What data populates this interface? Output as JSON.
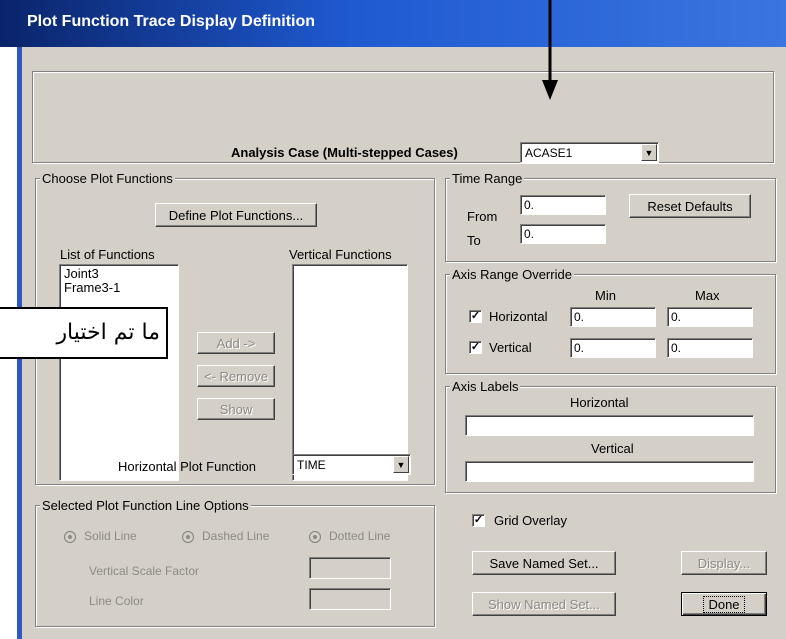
{
  "window": {
    "title": "Plot Function Trace Display Definition"
  },
  "analysis_case": {
    "label": "Analysis Case (Multi-stepped Cases)",
    "value": "ACASE1"
  },
  "choose_plot_functions": {
    "group_label": "Choose Plot Functions",
    "define_button": "Define Plot Functions...",
    "list_label": "List of Functions",
    "functions": [
      "Joint3",
      "Frame3-1"
    ],
    "vertical_label": "Vertical Functions",
    "add_button": "Add ->",
    "remove_button": "<- Remove",
    "show_button": "Show",
    "horizontal_plot_function_label": "Horizontal Plot Function",
    "horizontal_plot_function_value": "TIME"
  },
  "line_options": {
    "group_label": "Selected Plot Function Line Options",
    "solid": "Solid Line",
    "dashed": "Dashed Line",
    "dotted": "Dotted Line",
    "scale_label": "Vertical  Scale Factor",
    "color_label": "Line Color"
  },
  "time_range": {
    "group_label": "Time Range",
    "from_label": "From",
    "from_value": "0.",
    "to_label": "To",
    "to_value": "0.",
    "reset_button": "Reset Defaults"
  },
  "axis_range": {
    "group_label": "Axis Range Override",
    "min_label": "Min",
    "max_label": "Max",
    "horizontal_label": "Horizontal",
    "horizontal_min": "0.",
    "horizontal_max": "0.",
    "vertical_label": "Vertical",
    "vertical_min": "0.",
    "vertical_max": "0."
  },
  "axis_labels": {
    "group_label": "Axis Labels",
    "horizontal_label": "Horizontal",
    "horizontal_value": "",
    "vertical_label": "Vertical",
    "vertical_value": ""
  },
  "grid_overlay": {
    "label": "Grid Overlay",
    "checked": true
  },
  "buttons": {
    "save_named_set": "Save Named Set...",
    "show_named_set": "Show Named Set...",
    "display": "Display...",
    "done": "Done"
  },
  "annotation": {
    "callout_text": "ما تم اختيار"
  },
  "icons": {
    "arrow": "down-arrow-icon",
    "checkmark": "✓",
    "dropdown": "▼"
  },
  "colors": {
    "title_bar": "#0a246a",
    "dialog_bg": "#d4d0c8",
    "window_frame": "#2a56c8"
  }
}
